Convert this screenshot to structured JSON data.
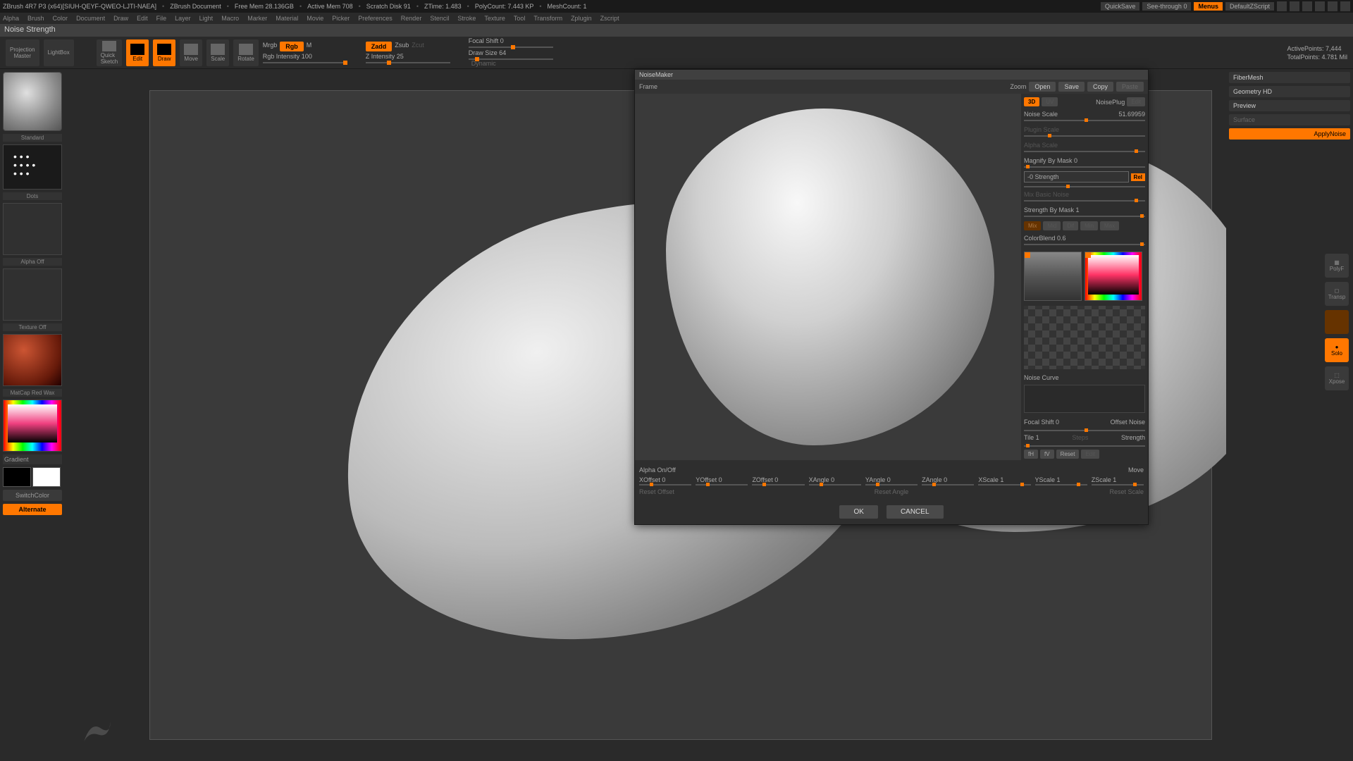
{
  "title": {
    "app": "ZBrush 4R7 P3 (x64)[SIUH-QEYF-QWEO-LJTI-NAEA]",
    "doc": "ZBrush Document",
    "freemem": "Free Mem 28.136GB",
    "activemem": "Active Mem 708",
    "scratch": "Scratch Disk 91",
    "ztime": "ZTime: 1.483",
    "polycount": "PolyCount: 7.443 KP",
    "meshcount": "MeshCount: 1",
    "quicksave": "QuickSave",
    "seethrough": "See-through  0",
    "menus": "Menus",
    "script": "DefaultZScript"
  },
  "menu": [
    "Alpha",
    "Brush",
    "Color",
    "Document",
    "Draw",
    "Edit",
    "File",
    "Layer",
    "Light",
    "Macro",
    "Marker",
    "Material",
    "Movie",
    "Picker",
    "Preferences",
    "Render",
    "Stencil",
    "Stroke",
    "Texture",
    "Tool",
    "Transform",
    "Zplugin",
    "Zscript"
  ],
  "status": "Noise Strength",
  "toolbar": {
    "projection": "Projection\nMaster",
    "lightbox": "LightBox",
    "quicksketch": "Quick\nSketch",
    "edit": "Edit",
    "draw": "Draw",
    "move": "Move",
    "scale": "Scale",
    "rotate": "Rotate",
    "mrgb": "Mrgb",
    "rgb": "Rgb",
    "m": "M",
    "rgbint": "Rgb Intensity 100",
    "zadd": "Zadd",
    "zsub": "Zsub",
    "zcut": "Zcut",
    "zint": "Z Intensity 25",
    "focal": "Focal Shift 0",
    "drawsize": "Draw Size 64",
    "dynamic": "Dynamic",
    "active": "ActivePoints: 7,444",
    "total": "TotalPoints: 4.781 Mil"
  },
  "left": {
    "standard": "Standard",
    "dots": "Dots",
    "alphaoff": "Alpha Off",
    "matcap": "MatCap Red Wax",
    "gradient": "Gradient",
    "switch": "SwitchColor",
    "alternate": "Alternate"
  },
  "right": {
    "fibermesh": "FiberMesh",
    "geomhd": "Geometry HD",
    "preview": "Preview",
    "surface": "Surface",
    "applynoise": "ApplyNoise",
    "polyf": "PolyF",
    "transp": "Transp",
    "solo": "Solo",
    "xpose": "Xpose"
  },
  "noise": {
    "panel_title": "NoiseMaker",
    "frame": "Frame",
    "zoom": "Zoom",
    "open": "Open",
    "save": "Save",
    "copy": "Copy",
    "paste": "Paste",
    "_3d": "3D",
    "uv": "UV",
    "noiseplug": "NoisePlug",
    "edit": "Edit",
    "noisescale": "Noise Scale",
    "noisescale_v": "51.69959",
    "pluginscale": "Plugin Scale",
    "alphascale": "Alpha Scale",
    "magnify": "Magnify By Mask 0",
    "strength": "-0 Strength",
    "rel": "Rel",
    "mixbasic": "Mix Basic Noise",
    "strmask": "Strength By Mask 1",
    "mix": "Mix",
    "mid": "Mid",
    "dif": "Dif",
    "min": "Min",
    "max": "Max",
    "colorblend": "ColorBlend 0.6",
    "noisecurve": "Noise Curve",
    "focalshift": "Focal Shift 0",
    "offsetnoise": "Offset  Noise",
    "tile": "Tile 1",
    "steps": "Steps",
    "strength2": "Strength",
    "fh": "fH",
    "fv": "fV",
    "reset": "Reset",
    "edit2": "Edit",
    "alphaon": "Alpha On/Off",
    "move": "Move",
    "xoff": "XOffset 0",
    "yoff": "YOffset 0",
    "zoff": "ZOffset 0",
    "xang": "XAngle 0",
    "yang": "YAngle 0",
    "zang": "ZAngle 0",
    "xsc": "XScale 1",
    "ysc": "YScale 1",
    "zsc": "ZScale 1",
    "resetoff": "Reset Offset",
    "resetang": "Reset Angle",
    "resetsc": "Reset Scale",
    "ok": "OK",
    "cancel": "CANCEL"
  }
}
